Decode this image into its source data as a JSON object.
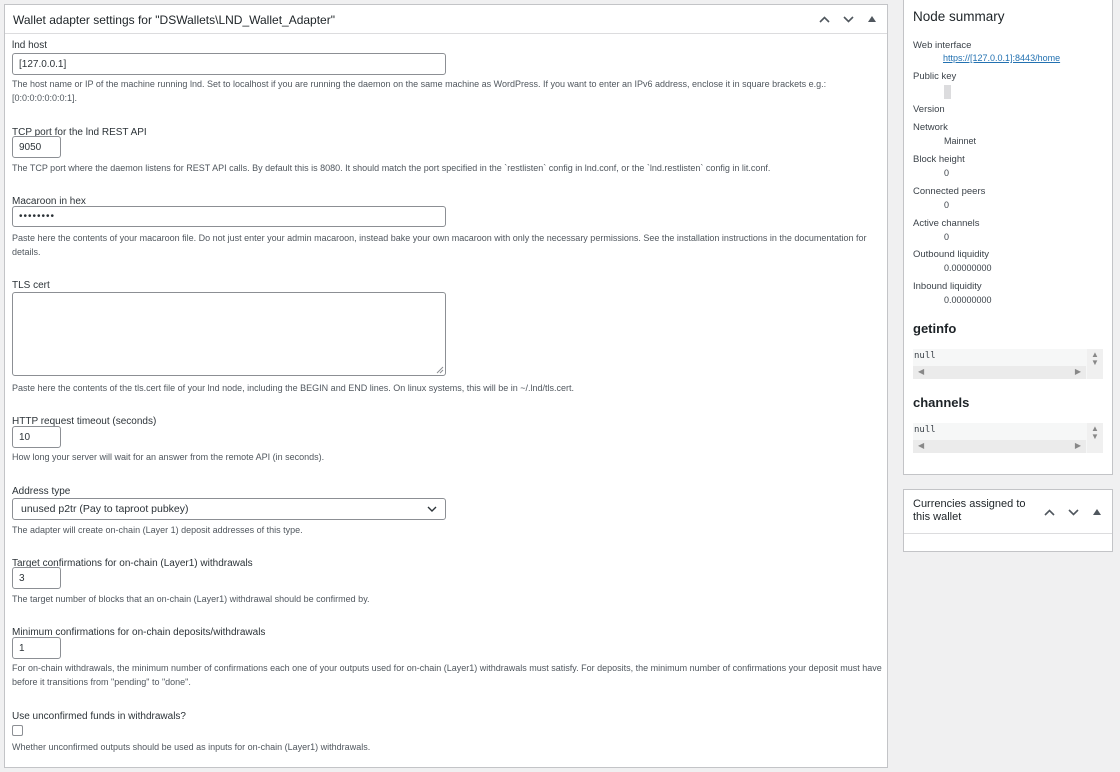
{
  "main": {
    "title": "Wallet adapter settings for \"DSWallets\\LND_Wallet_Adapter\"",
    "fields": {
      "lnd_host": {
        "label": "lnd host",
        "value": "[127.0.0.1]",
        "desc": "The host name or IP of the machine running lnd. Set to localhost if you are running the daemon on the same machine as WordPress. If you want to enter an IPv6 address, enclose it in square brackets e.g.: [0:0:0:0:0:0:0:1]."
      },
      "tcp_port": {
        "label": "TCP port for the lnd REST API",
        "value": "9050",
        "desc": "The TCP port where the daemon listens for REST API calls. By default this is 8080. It should match the port specified in the `restlisten` config in lnd.conf, or the `lnd.restlisten` config in lit.conf."
      },
      "macaroon": {
        "label": "Macaroon in hex",
        "value": "••••••••",
        "desc": "Paste here the contents of your macaroon file. Do not just enter your admin macaroon, instead bake your own macaroon with only the necessary permissions. See the installation instructions in the documentation for details."
      },
      "tls_cert": {
        "label": "TLS cert",
        "value": "",
        "desc": "Paste here the contents of the tls.cert file of your lnd node, including the BEGIN and END lines. On linux systems, this will be in ~/.lnd/tls.cert."
      },
      "http_timeout": {
        "label": "HTTP request timeout (seconds)",
        "value": "10",
        "desc": "How long your server will wait for an answer from the remote API (in seconds)."
      },
      "address_type": {
        "label": "Address type",
        "value": "unused p2tr (Pay to taproot pubkey)",
        "desc": "The adapter will create on-chain (Layer 1) deposit addresses of this type."
      },
      "target_conf": {
        "label": "Target confirmations for on-chain (Layer1) withdrawals",
        "value": "3",
        "desc": "The target number of blocks that an on-chain (Layer1) withdrawal should be confirmed by."
      },
      "min_conf": {
        "label": "Minimum confirmations for on-chain deposits/withdrawals",
        "value": "1",
        "desc": "For on-chain withdrawals, the minimum number of confirmations each one of your outputs used for on-chain (Layer1) withdrawals must satisfy. For deposits, the minimum number of confirmations your deposit must have before it transitions from \"pending\" to \"done\"."
      },
      "unconfirmed": {
        "label": "Use unconfirmed funds in withdrawals?",
        "checked": false,
        "desc": "Whether unconfirmed outputs should be used as inputs for on-chain (Layer1) withdrawals."
      }
    }
  },
  "side": {
    "title": "Node summary",
    "web_interface_label": "Web interface",
    "web_interface_link": "https://[127.0.0.1]:8443/home",
    "public_key_label": "Public key",
    "version_label": "Version",
    "network_label": "Network",
    "network_value": "Mainnet",
    "block_height_label": "Block height",
    "block_height_value": "0",
    "connected_peers_label": "Connected peers",
    "connected_peers_value": "0",
    "active_channels_label": "Active channels",
    "active_channels_value": "0",
    "outbound_label": "Outbound liquidity",
    "outbound_value": "0.00000000",
    "inbound_label": "Inbound liquidity",
    "inbound_value": "0.00000000",
    "getinfo_title": "getinfo",
    "getinfo_value": "null",
    "channels_title": "channels",
    "channels_value": "null"
  },
  "currencies": {
    "title": "Currencies assigned to this wallet"
  }
}
